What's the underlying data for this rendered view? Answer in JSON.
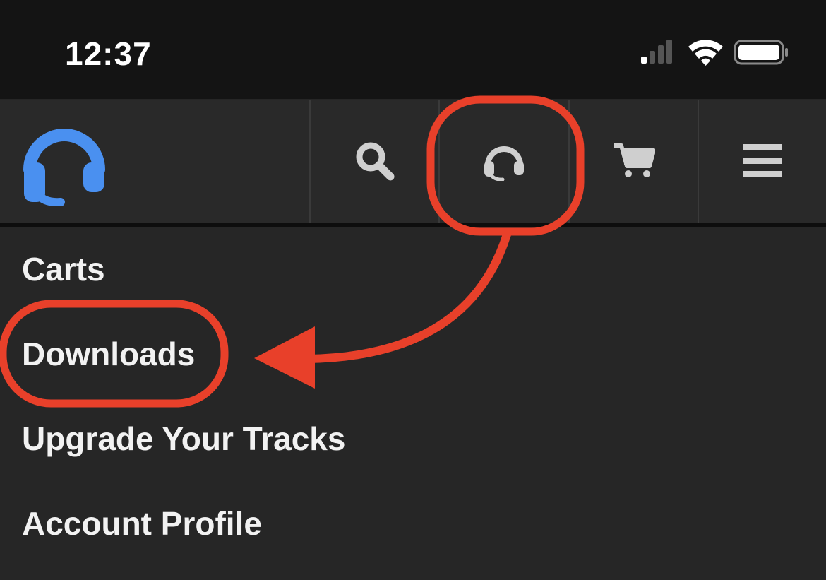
{
  "status_bar": {
    "time": "12:37",
    "icons": [
      "cellular-signal-icon",
      "wifi-icon",
      "battery-icon"
    ]
  },
  "nav": {
    "logo_icon": "headphones-logo",
    "buttons": [
      {
        "name": "search",
        "icon": "search-icon"
      },
      {
        "name": "downloads",
        "icon": "headset-icon"
      },
      {
        "name": "cart",
        "icon": "cart-icon"
      },
      {
        "name": "menu",
        "icon": "hamburger-icon"
      }
    ]
  },
  "menu": {
    "items": [
      {
        "label": "Carts"
      },
      {
        "label": "Downloads"
      },
      {
        "label": "Upgrade Your Tracks"
      },
      {
        "label": "Account Profile"
      }
    ]
  },
  "colors": {
    "brand_blue": "#4a90f0",
    "annotation_red": "#e8402a",
    "icon_gray": "#cfcfcf",
    "background": "#262626"
  }
}
